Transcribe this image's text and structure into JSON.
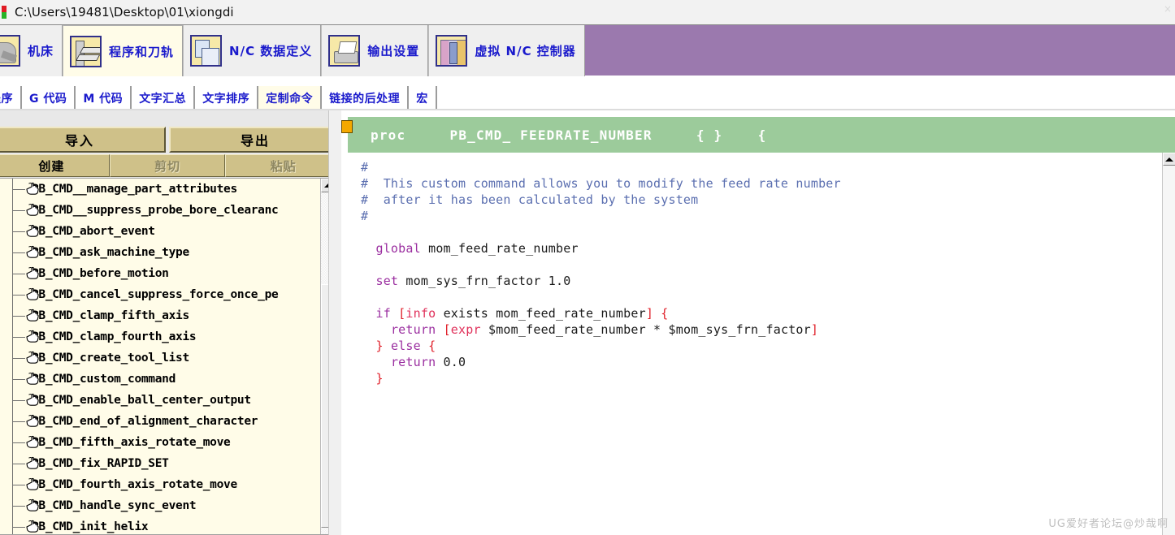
{
  "titlebar": {
    "path": "C:\\Users\\19481\\Desktop\\01\\xiongdi",
    "close_label": "×"
  },
  "ribbon": {
    "background_color": "#9b79ae",
    "tabs": [
      {
        "label": "机床",
        "icon": "machine-icon",
        "active": false
      },
      {
        "label": "程序和刀轨",
        "icon": "program-toolpath-icon",
        "active": true
      },
      {
        "label": "N/C 数据定义",
        "icon": "nc-data-definition-icon",
        "active": false
      },
      {
        "label": "输出设置",
        "icon": "printer-icon",
        "active": false
      },
      {
        "label": "虚拟 N/C 控制器",
        "icon": "virtual-nc-controller-icon",
        "active": false
      }
    ]
  },
  "subtabs": {
    "items": [
      {
        "label": "程序",
        "active": false
      },
      {
        "label": "G 代码",
        "active": false
      },
      {
        "label": "M 代码",
        "active": false
      },
      {
        "label": "文字汇总",
        "active": false
      },
      {
        "label": "文字排序",
        "active": false
      },
      {
        "label": "定制命令",
        "active": true
      },
      {
        "label": "链接的后处理",
        "active": false
      },
      {
        "label": "宏",
        "active": false
      }
    ]
  },
  "left_panel": {
    "big_buttons": [
      {
        "label": "导入",
        "enabled": true
      },
      {
        "label": "导出",
        "enabled": true
      }
    ],
    "small_buttons": [
      {
        "label": "创建",
        "enabled": true
      },
      {
        "label": "剪切",
        "enabled": false
      },
      {
        "label": "粘贴",
        "enabled": false
      }
    ],
    "tree_items": [
      {
        "label": "PB_CMD__manage_part_attributes"
      },
      {
        "label": "PB_CMD__suppress_probe_bore_clearanc"
      },
      {
        "label": "PB_CMD_abort_event"
      },
      {
        "label": "PB_CMD_ask_machine_type"
      },
      {
        "label": "PB_CMD_before_motion"
      },
      {
        "label": "PB_CMD_cancel_suppress_force_once_pe"
      },
      {
        "label": "PB_CMD_clamp_fifth_axis"
      },
      {
        "label": "PB_CMD_clamp_fourth_axis"
      },
      {
        "label": "PB_CMD_create_tool_list"
      },
      {
        "label": "PB_CMD_custom_command"
      },
      {
        "label": "PB_CMD_enable_ball_center_output"
      },
      {
        "label": "PB_CMD_end_of_alignment_character"
      },
      {
        "label": "PB_CMD_fifth_axis_rotate_move"
      },
      {
        "label": "PB_CMD_fix_RAPID_SET"
      },
      {
        "label": "PB_CMD_fourth_axis_rotate_move"
      },
      {
        "label": "PB_CMD_handle_sync_event"
      },
      {
        "label": "PB_CMD_init_helix"
      }
    ]
  },
  "editor": {
    "header_text": "proc     PB_CMD_ FEEDRATE_NUMBER     { }    {",
    "header_color": "#9ccb9b",
    "lines": [
      [
        {
          "t": "#",
          "c": "comment"
        }
      ],
      [
        {
          "t": "#  This custom command allows you to modify the feed rate number",
          "c": "comment"
        }
      ],
      [
        {
          "t": "#  after it has been calculated by the system",
          "c": "comment"
        }
      ],
      [
        {
          "t": "#",
          "c": "comment"
        }
      ],
      [
        {
          "t": "",
          "c": "plain"
        }
      ],
      [
        {
          "t": "  ",
          "c": "plain"
        },
        {
          "t": "global",
          "c": "kw"
        },
        {
          "t": " mom_feed_rate_number",
          "c": "plain"
        }
      ],
      [
        {
          "t": "",
          "c": "plain"
        }
      ],
      [
        {
          "t": "  ",
          "c": "plain"
        },
        {
          "t": "set",
          "c": "kw"
        },
        {
          "t": " mom_sys_frn_factor 1.0",
          "c": "plain"
        }
      ],
      [
        {
          "t": "",
          "c": "plain"
        }
      ],
      [
        {
          "t": "  ",
          "c": "plain"
        },
        {
          "t": "if",
          "c": "kw"
        },
        {
          "t": " ",
          "c": "plain"
        },
        {
          "t": "[",
          "c": "punct"
        },
        {
          "t": "info",
          "c": "cmd"
        },
        {
          "t": " exists mom_feed_rate_number",
          "c": "plain"
        },
        {
          "t": "]",
          "c": "punct"
        },
        {
          "t": " ",
          "c": "plain"
        },
        {
          "t": "{",
          "c": "punct"
        }
      ],
      [
        {
          "t": "    ",
          "c": "plain"
        },
        {
          "t": "return",
          "c": "kw"
        },
        {
          "t": " ",
          "c": "plain"
        },
        {
          "t": "[",
          "c": "punct"
        },
        {
          "t": "expr",
          "c": "cmd"
        },
        {
          "t": " $mom_feed_rate_number * $mom_sys_frn_factor",
          "c": "plain"
        },
        {
          "t": "]",
          "c": "punct"
        }
      ],
      [
        {
          "t": "  ",
          "c": "plain"
        },
        {
          "t": "}",
          "c": "punct"
        },
        {
          "t": " ",
          "c": "plain"
        },
        {
          "t": "else",
          "c": "kw"
        },
        {
          "t": " ",
          "c": "plain"
        },
        {
          "t": "{",
          "c": "punct"
        }
      ],
      [
        {
          "t": "    ",
          "c": "plain"
        },
        {
          "t": "return",
          "c": "kw"
        },
        {
          "t": " 0.0",
          "c": "plain"
        }
      ],
      [
        {
          "t": "  ",
          "c": "plain"
        },
        {
          "t": "}",
          "c": "punct"
        }
      ]
    ]
  },
  "watermark": {
    "text": "UG爱好者论坛@炒哉啊"
  },
  "colors": {
    "ribbon_purple": "#9b79ae",
    "button_tan": "#cfc189",
    "tree_bg": "#fffce8",
    "proc_header_green": "#9ccb9b",
    "tab_text_blue": "#1a1acc"
  }
}
